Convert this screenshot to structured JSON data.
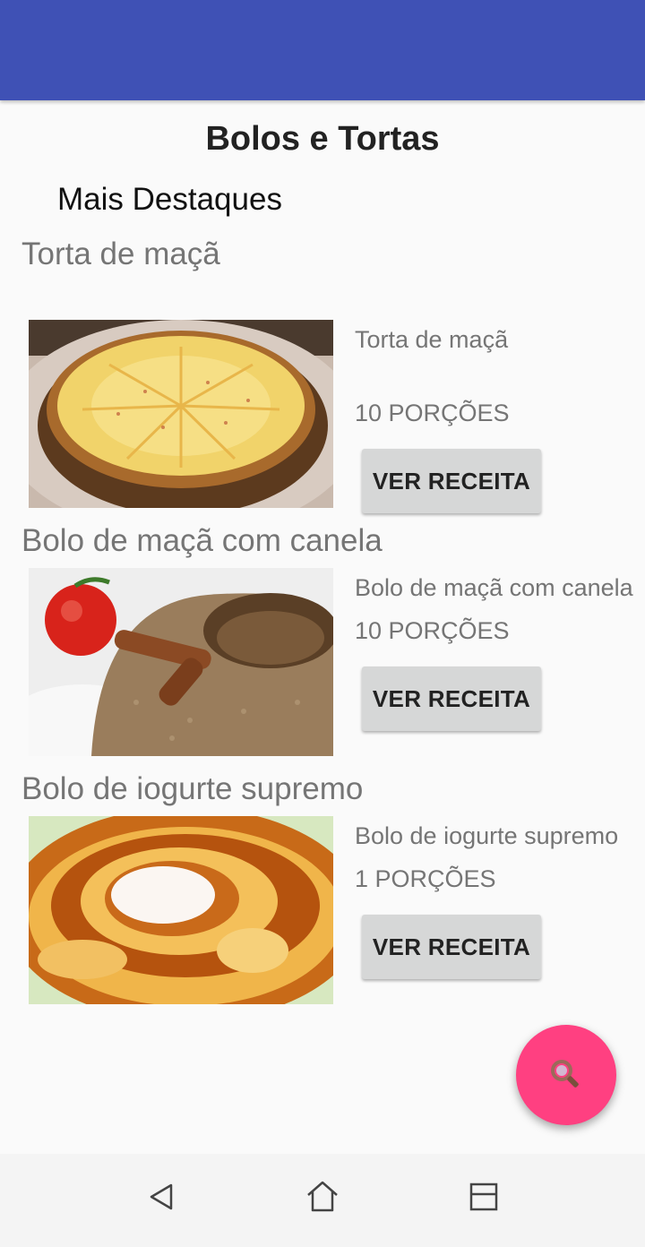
{
  "header": {
    "color": "#3f51b5"
  },
  "page_title": "Bolos e Tortas",
  "section_title": "Mais Destaques",
  "recipes": [
    {
      "heading": "Torta de maçã",
      "name": "Torta de maçã",
      "portions": "10 PORÇÕES",
      "button_label": "VER RECEITA",
      "image": "apple-pie-photo"
    },
    {
      "heading": "Bolo de maçã com canela",
      "name": "Bolo de maçã com canela",
      "portions": "10 PORÇÕES",
      "button_label": "VER RECEITA",
      "image": "apple-cinnamon-cake-photo"
    },
    {
      "heading": "Bolo de iogurte supremo",
      "name": "Bolo de iogurte supremo",
      "portions": "1 PORÇÕES",
      "button_label": "VER RECEITA",
      "image": "yogurt-cake-photo"
    }
  ],
  "fab": {
    "icon": "search-icon",
    "color": "#ff4081"
  },
  "navbar": {
    "icons": [
      "back-icon",
      "home-icon",
      "recents-icon"
    ]
  }
}
